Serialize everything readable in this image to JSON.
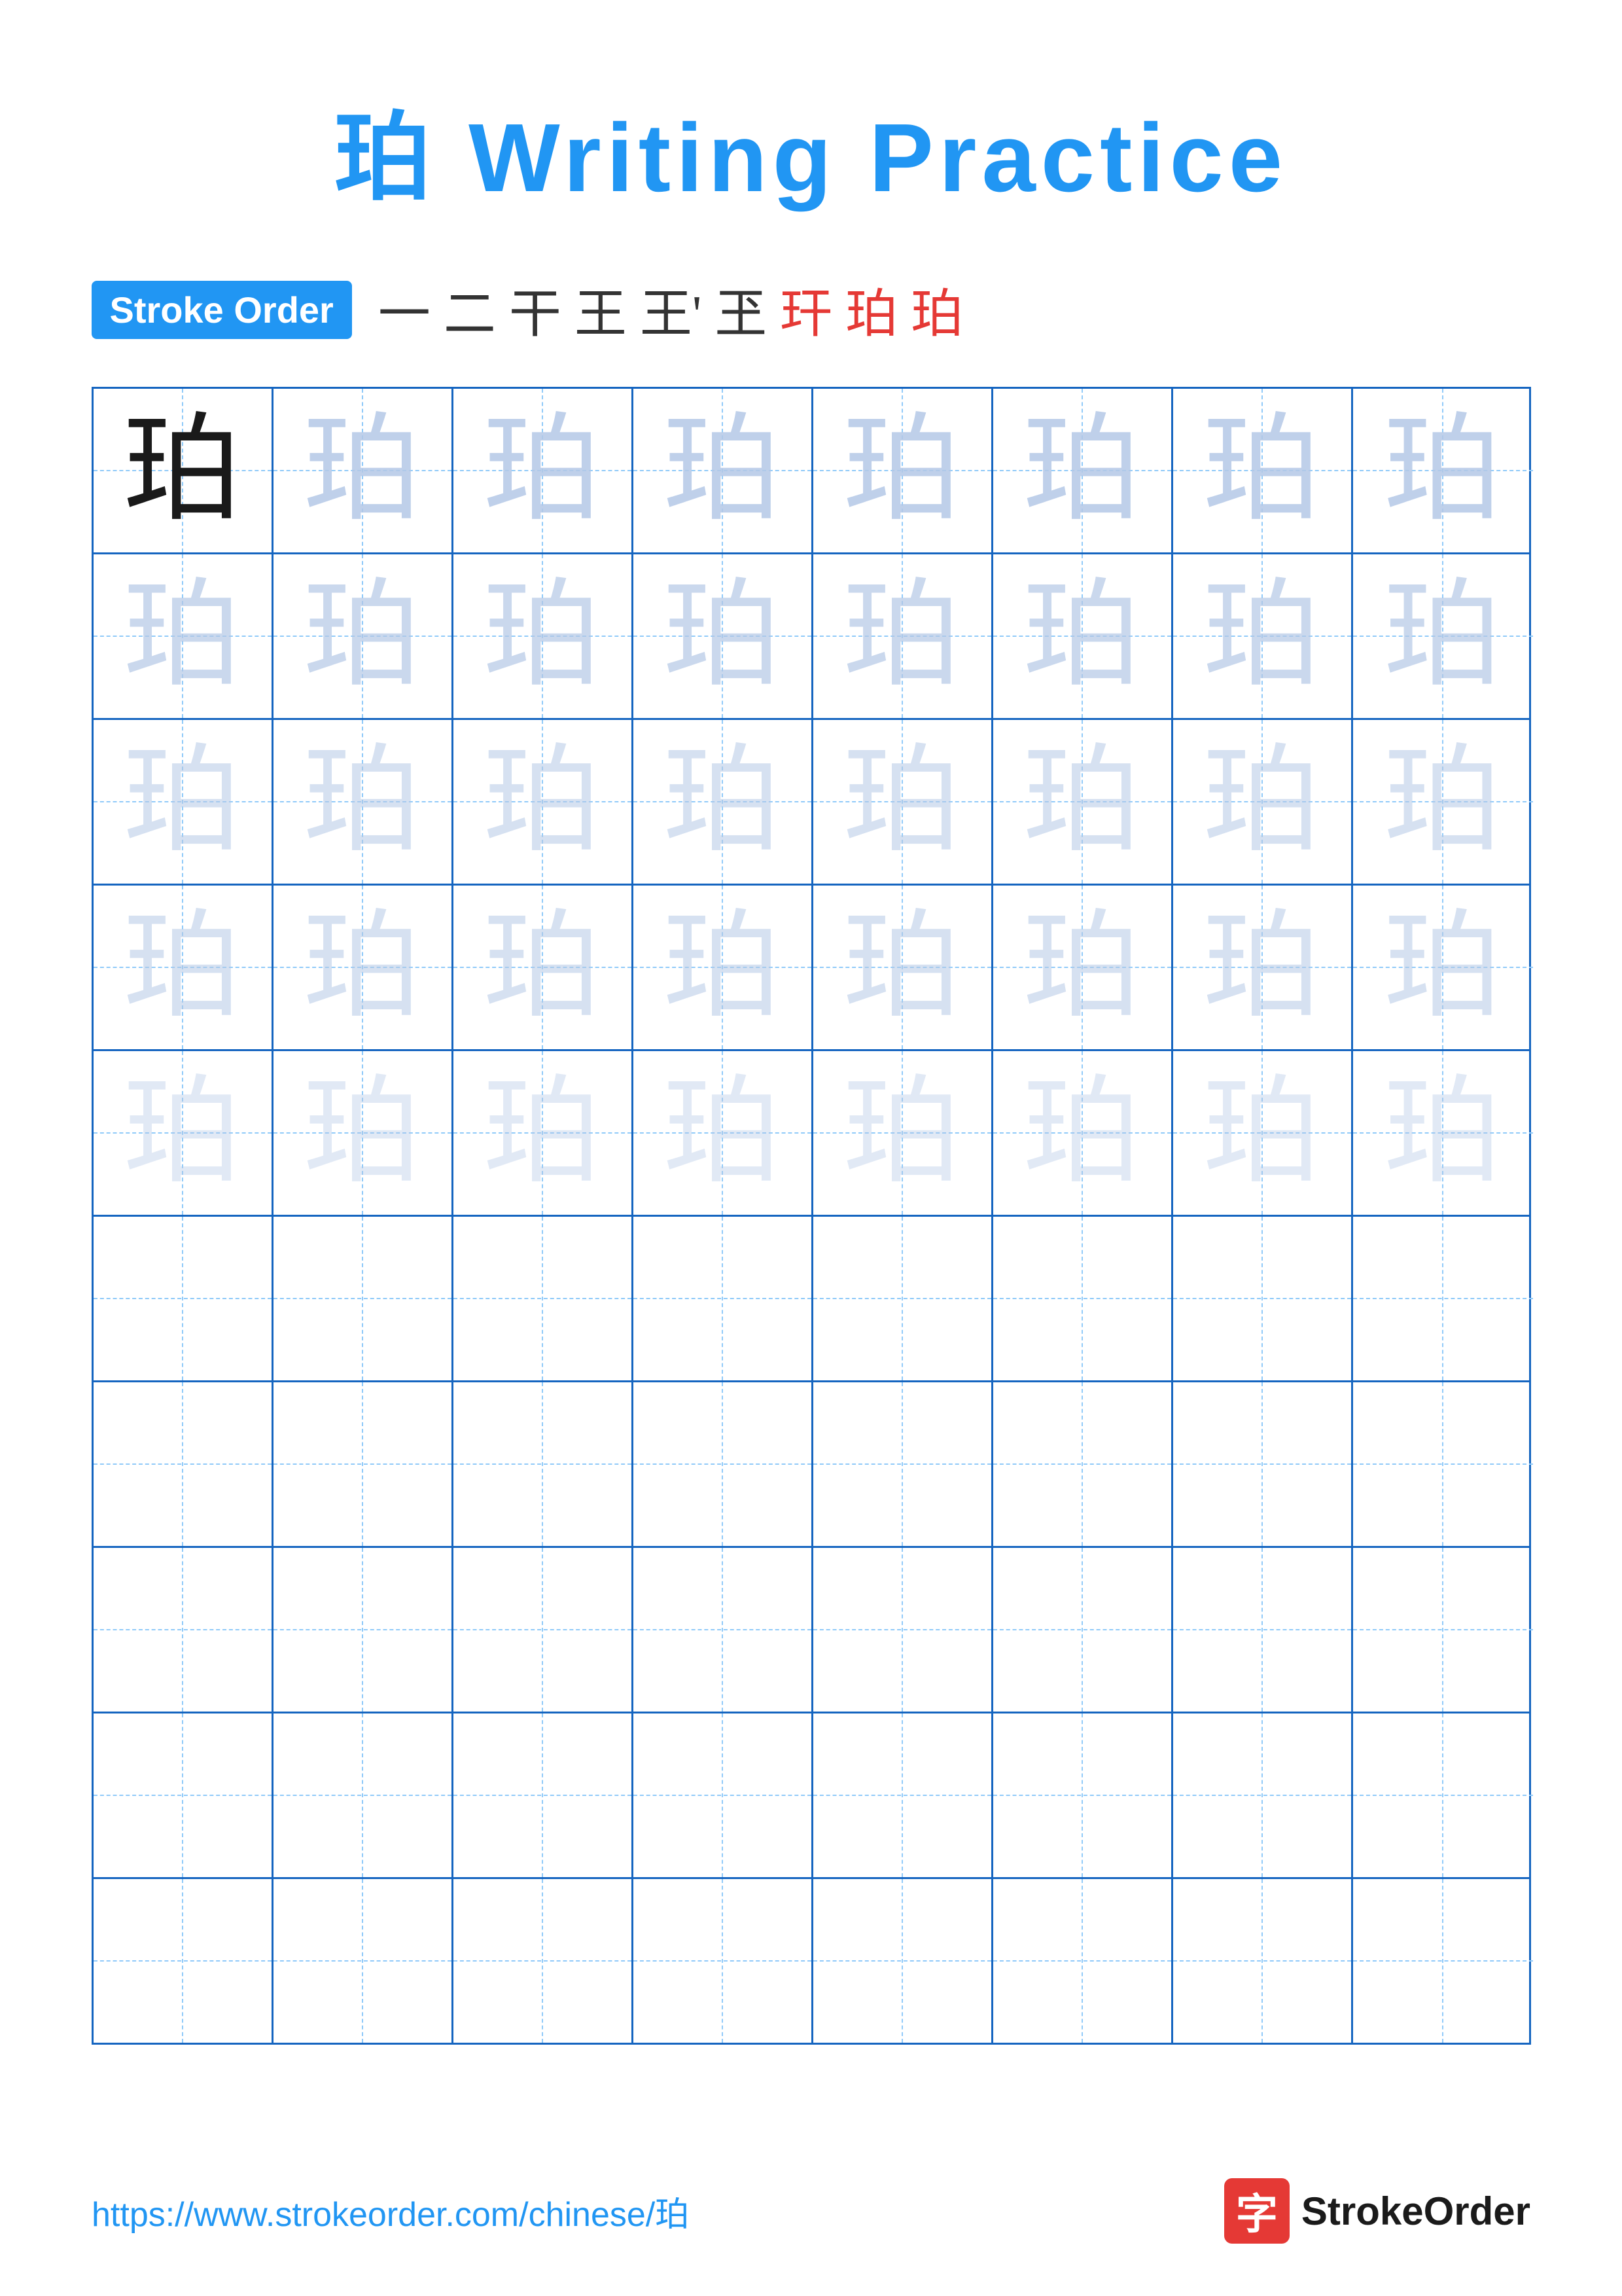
{
  "title": "珀 Writing Practice",
  "stroke_order": {
    "badge_label": "Stroke Order",
    "steps": [
      "一",
      "二",
      "干",
      "王",
      "王'",
      "玊",
      "玕",
      "珀",
      "珀"
    ]
  },
  "character": "珀",
  "grid": {
    "rows": 10,
    "cols": 8,
    "filled_rows": 5,
    "empty_rows": 5
  },
  "footer": {
    "url": "https://www.strokeorder.com/chinese/珀",
    "brand": "StrokeOrder",
    "brand_char": "字"
  }
}
